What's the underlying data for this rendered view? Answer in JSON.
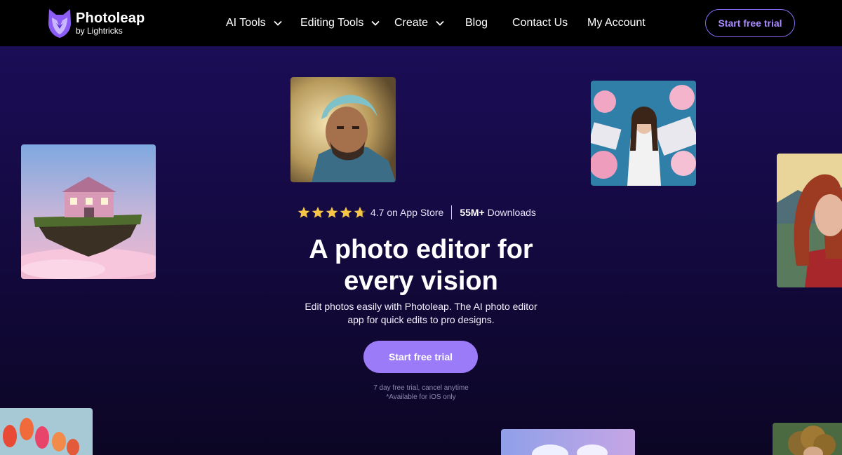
{
  "brand": {
    "name": "Photoleap",
    "tagline": "by Lightricks",
    "accent": "#9b7bf7",
    "logo_icon": "fox-head-icon"
  },
  "nav": {
    "items": [
      {
        "label": "AI Tools",
        "dropdown": true
      },
      {
        "label": "Editing Tools",
        "dropdown": true
      },
      {
        "label": "Create",
        "dropdown": true
      },
      {
        "label": "Blog",
        "dropdown": false
      },
      {
        "label": "Contact Us",
        "dropdown": false
      },
      {
        "label": "My Account",
        "dropdown": false
      }
    ],
    "cta_label": "Start free trial"
  },
  "hero": {
    "rating_stars": 4.7,
    "rating_text": "4.7 on App Store",
    "downloads_bold": "55M+",
    "downloads_text": "Downloads",
    "headline_line1": "A photo editor for",
    "headline_line2": "every vision",
    "subtext_line1": "Edit photos easily with Photoleap. The AI photo editor",
    "subtext_line2": "app for quick edits to pro designs.",
    "cta_label": "Start free trial",
    "fine_line1": "7 day free trial, cancel anytime",
    "fine_line2": "*Available for iOS only"
  },
  "gallery": [
    {
      "subject": "floating-island-house"
    },
    {
      "subject": "warrior-portrait"
    },
    {
      "subject": "floral-collage-portrait"
    },
    {
      "subject": "red-haired-woman-portrait"
    },
    {
      "subject": "tulips"
    },
    {
      "subject": "pastel-sky"
    },
    {
      "subject": "curly-hair-portrait"
    }
  ]
}
